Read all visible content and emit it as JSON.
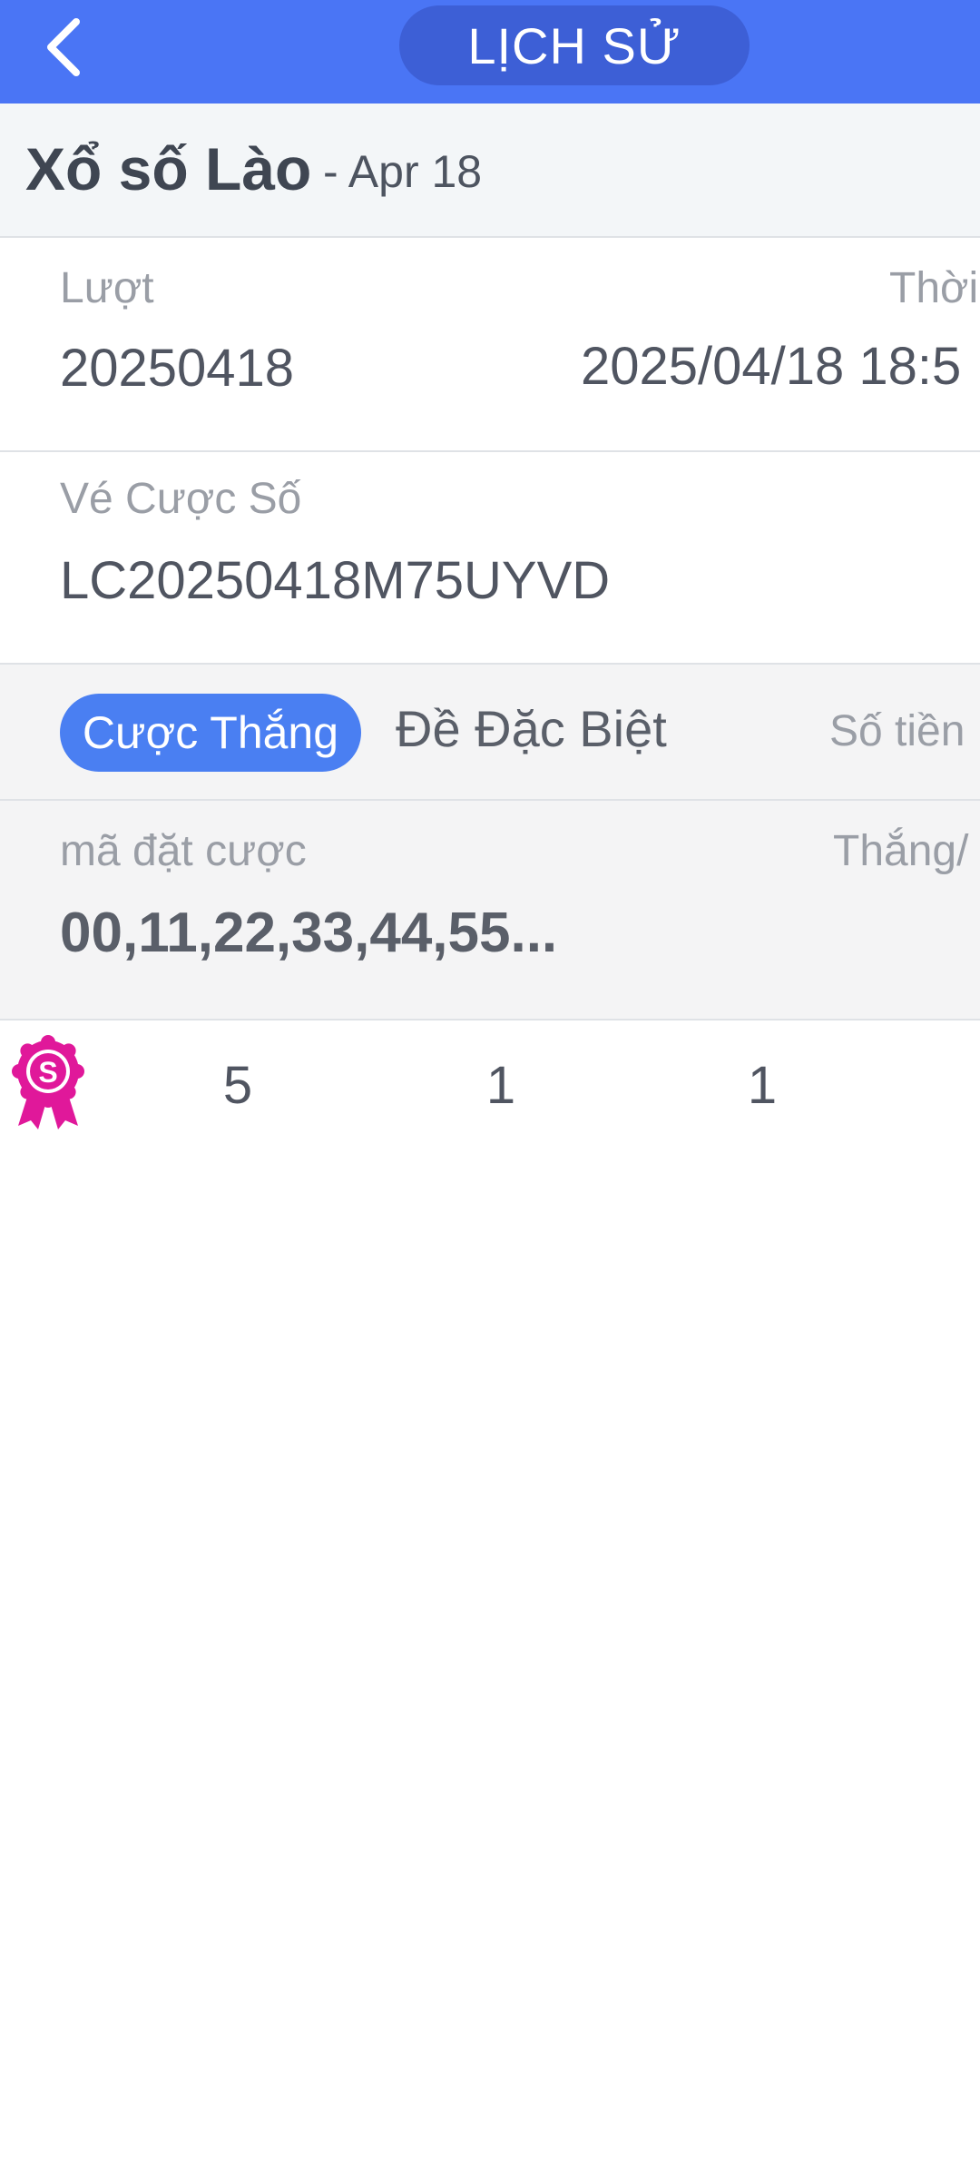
{
  "header": {
    "title": "LỊCH SỬ",
    "back_icon": "chevron-left-icon",
    "bg_color": "#4a75f5"
  },
  "game": {
    "name": "Xổ số Lào",
    "date": "- Apr 18"
  },
  "round": {
    "label": "Lượt",
    "value": "20250418",
    "time_label": "Thời",
    "time_value": "2025/04/18 18:5"
  },
  "ticket": {
    "label": "Vé Cược Số",
    "value": "LC20250418M75UYVD"
  },
  "bet": {
    "status": "Cược Thắng",
    "status_color": "#4a7ff2",
    "type": "Đề Đặc Biệt",
    "amount_label": "Số tiền"
  },
  "code": {
    "label": "mã đặt cược",
    "value": "00,11,22,33,44,55...",
    "result_label": "Thắng/"
  },
  "stats": {
    "badge_icon": "prize-ribbon-icon",
    "badge_letter": "S",
    "badge_color": "#e0189a",
    "values": [
      "5",
      "1",
      "1"
    ]
  }
}
